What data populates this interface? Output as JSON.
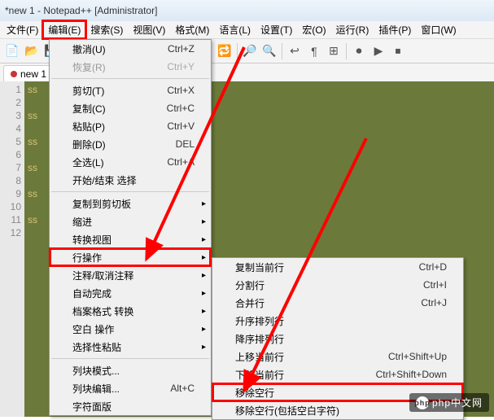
{
  "title": "*new 1 - Notepad++ [Administrator]",
  "menubar": [
    "文件(F)",
    "编辑(E)",
    "搜索(S)",
    "视图(V)",
    "格式(M)",
    "语言(L)",
    "设置(T)",
    "宏(O)",
    "运行(R)",
    "插件(P)",
    "窗口(W)"
  ],
  "menubar_highlight_index": 1,
  "tab": {
    "label": "new 1"
  },
  "line_numbers": [
    "1",
    "2",
    "3",
    "4",
    "5",
    "6",
    "7",
    "8",
    "9",
    "10",
    "11",
    "12"
  ],
  "code_lines": [
    "ss",
    "",
    "ss",
    "",
    "ss",
    "",
    "ss",
    "",
    "ss",
    "",
    "ss",
    ""
  ],
  "edit_menu": [
    {
      "type": "item",
      "label": "撤消(U)",
      "shortcut": "Ctrl+Z"
    },
    {
      "type": "item",
      "label": "恢复(R)",
      "shortcut": "Ctrl+Y",
      "disabled": true
    },
    {
      "type": "sep"
    },
    {
      "type": "item",
      "label": "剪切(T)",
      "shortcut": "Ctrl+X"
    },
    {
      "type": "item",
      "label": "复制(C)",
      "shortcut": "Ctrl+C"
    },
    {
      "type": "item",
      "label": "粘贴(P)",
      "shortcut": "Ctrl+V"
    },
    {
      "type": "item",
      "label": "删除(D)",
      "shortcut": "DEL"
    },
    {
      "type": "item",
      "label": "全选(L)",
      "shortcut": "Ctrl+A"
    },
    {
      "type": "item",
      "label": "开始/结束 选择"
    },
    {
      "type": "sep"
    },
    {
      "type": "item",
      "label": "复制到剪切板",
      "sub": true
    },
    {
      "type": "item",
      "label": "缩进",
      "sub": true
    },
    {
      "type": "item",
      "label": "转换视图",
      "sub": true
    },
    {
      "type": "item",
      "label": "行操作",
      "sub": true,
      "boxed": true
    },
    {
      "type": "item",
      "label": "注释/取消注释",
      "sub": true
    },
    {
      "type": "item",
      "label": "自动完成",
      "sub": true
    },
    {
      "type": "item",
      "label": "档案格式 转换",
      "sub": true
    },
    {
      "type": "item",
      "label": "空白 操作",
      "sub": true
    },
    {
      "type": "item",
      "label": "选择性粘贴",
      "sub": true
    },
    {
      "type": "sep"
    },
    {
      "type": "item",
      "label": "列块模式..."
    },
    {
      "type": "item",
      "label": "列块编辑...",
      "shortcut": "Alt+C"
    },
    {
      "type": "item",
      "label": "字符面版"
    }
  ],
  "sub_menu": [
    {
      "type": "item",
      "label": "复制当前行",
      "shortcut": "Ctrl+D"
    },
    {
      "type": "item",
      "label": "分割行",
      "shortcut": "Ctrl+I"
    },
    {
      "type": "item",
      "label": "合并行",
      "shortcut": "Ctrl+J"
    },
    {
      "type": "item",
      "label": "升序排列行"
    },
    {
      "type": "item",
      "label": "降序排列行"
    },
    {
      "type": "item",
      "label": "上移当前行",
      "shortcut": "Ctrl+Shift+Up"
    },
    {
      "type": "item",
      "label": "下移当前行",
      "shortcut": "Ctrl+Shift+Down"
    },
    {
      "type": "item",
      "label": "移除空行",
      "boxed": true
    },
    {
      "type": "item",
      "label": "移除空行(包括空白字符)"
    }
  ],
  "watermark": "php中文网"
}
